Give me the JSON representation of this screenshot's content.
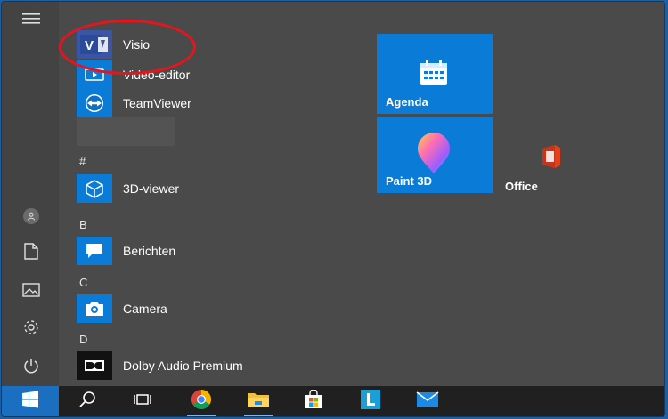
{
  "apps": {
    "visio": "Visio",
    "video_editor": "Video-editor",
    "teamviewer": "TeamViewer",
    "viewer3d": "3D-viewer",
    "berichten": "Berichten",
    "camera": "Camera",
    "dolby": "Dolby Audio Premium"
  },
  "letters": {
    "hash": "#",
    "b": "B",
    "c": "C",
    "d": "D"
  },
  "tiles": {
    "agenda": "Agenda",
    "paint3d": "Paint 3D",
    "office": "Office"
  },
  "colors": {
    "tile_blue": "#0a7bd6",
    "start_blue": "#1a6fc0",
    "annotation_red": "#e8141c"
  },
  "icons": [
    "hamburger-icon",
    "user-icon",
    "document-icon",
    "pictures-icon",
    "settings-icon",
    "power-icon",
    "windows-icon",
    "search-icon",
    "task-view-icon",
    "chrome-icon",
    "file-explorer-icon",
    "store-icon",
    "l-app-icon",
    "mail-icon"
  ]
}
